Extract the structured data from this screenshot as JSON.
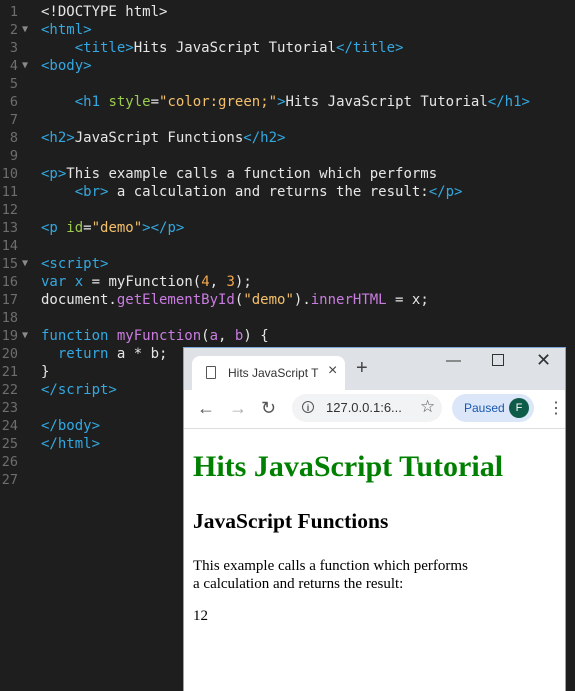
{
  "editor": {
    "lines": [
      {
        "n": "1",
        "fold": false,
        "html": "&lt;!DOCTYPE html&gt;"
      },
      {
        "n": "2",
        "fold": true,
        "html": "<span class='tag'>&lt;html&gt;</span>"
      },
      {
        "n": "3",
        "fold": false,
        "html": "    <span class='tag'>&lt;title&gt;</span>Hits JavaScript Tutorial<span class='tag'>&lt;/title&gt;</span>"
      },
      {
        "n": "4",
        "fold": true,
        "html": "<span class='tag'>&lt;body&gt;</span>"
      },
      {
        "n": "5",
        "fold": false,
        "html": ""
      },
      {
        "n": "6",
        "fold": false,
        "html": "    <span class='tag'>&lt;h1</span> <span class='attr'>style</span>=<span class='str'>\"color:green;\"</span><span class='tag'>&gt;</span>Hits JavaScript Tutorial<span class='tag'>&lt;/h1&gt;</span>"
      },
      {
        "n": "7",
        "fold": false,
        "html": ""
      },
      {
        "n": "8",
        "fold": false,
        "html": "<span class='tag'>&lt;h2&gt;</span>JavaScript Functions<span class='tag'>&lt;/h2&gt;</span>"
      },
      {
        "n": "9",
        "fold": false,
        "html": ""
      },
      {
        "n": "10",
        "fold": false,
        "html": "<span class='tag'>&lt;p&gt;</span>This example calls a function which performs"
      },
      {
        "n": "11",
        "fold": false,
        "html": "    <span class='tag'>&lt;br&gt;</span> a calculation and returns the result:<span class='tag'>&lt;/p&gt;</span>"
      },
      {
        "n": "12",
        "fold": false,
        "html": ""
      },
      {
        "n": "13",
        "fold": false,
        "html": "<span class='tag'>&lt;p</span> <span class='attr'>id</span>=<span class='str'>\"demo\"</span><span class='tag'>&gt;&lt;/p&gt;</span>"
      },
      {
        "n": "14",
        "fold": false,
        "html": ""
      },
      {
        "n": "15",
        "fold": true,
        "html": "<span class='tag'>&lt;script&gt;</span>"
      },
      {
        "n": "16",
        "fold": false,
        "html": "<span class='kw'>var</span> <span class='kw'>x</span> = myFunction(<span class='num'>4</span>, <span class='num'>3</span>);"
      },
      {
        "n": "17",
        "fold": false,
        "html": "document.<span class='prop'>getElementById</span>(<span class='str'>\"demo\"</span>).<span class='prop'>innerHTML</span> = x;"
      },
      {
        "n": "18",
        "fold": false,
        "html": ""
      },
      {
        "n": "19",
        "fold": true,
        "html": "<span class='kw'>function</span> <span class='fn'>myFunction</span>(<span class='fn'>a</span>, <span class='fn'>b</span>) {"
      },
      {
        "n": "20",
        "fold": false,
        "html": "  <span class='kw'>return</span> a * b;"
      },
      {
        "n": "21",
        "fold": false,
        "html": "}"
      },
      {
        "n": "22",
        "fold": false,
        "html": "<span class='tag'>&lt;/script&gt;</span>"
      },
      {
        "n": "23",
        "fold": false,
        "html": ""
      },
      {
        "n": "24",
        "fold": false,
        "html": "<span class='tag'>&lt;/body&gt;</span>"
      },
      {
        "n": "25",
        "fold": false,
        "html": "<span class='tag'>&lt;/html&gt;</span>"
      },
      {
        "n": "26",
        "fold": false,
        "html": ""
      },
      {
        "n": "27",
        "fold": false,
        "html": ""
      }
    ]
  },
  "browser": {
    "tab_title": "Hits JavaScript T",
    "url": "127.0.0.1:6...",
    "paused_label": "Paused",
    "avatar_letter": "F",
    "page": {
      "h1": "Hits JavaScript Tutorial",
      "h1_color": "#008000",
      "h2": "JavaScript Functions",
      "p_line1": "This example calls a function which performs",
      "p_line2": "a calculation and returns the result:",
      "demo": "12"
    }
  }
}
